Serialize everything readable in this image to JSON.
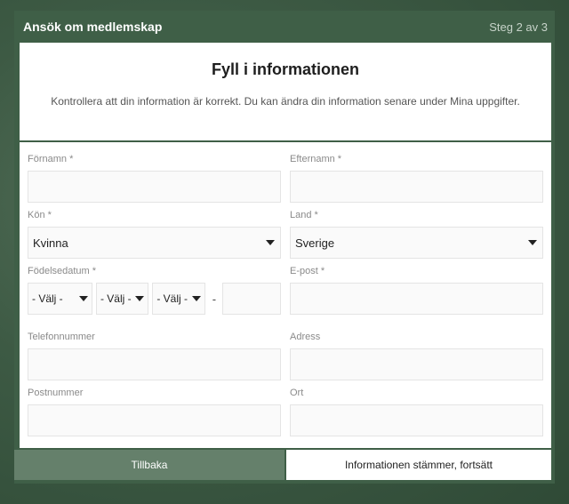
{
  "header": {
    "title": "Ansök om medlemskap",
    "step": "Steg 2 av 3"
  },
  "intro": {
    "title": "Fyll i informationen",
    "text": "Kontrollera att din information är korrekt. Du kan ändra din information senare under Mina uppgifter."
  },
  "form": {
    "first_name": {
      "label": "Förnamn *",
      "value": ""
    },
    "last_name": {
      "label": "Efternamn *",
      "value": ""
    },
    "gender": {
      "label": "Kön *",
      "selected": "Kvinna"
    },
    "country": {
      "label": "Land *",
      "selected": "Sverige"
    },
    "birthdate": {
      "label": "Födelsedatum *",
      "year": "- Välj -",
      "month": "- Välj -",
      "day": "- Välj -",
      "separator": "-",
      "suffix_value": ""
    },
    "email": {
      "label": "E-post *",
      "value": ""
    },
    "phone": {
      "label": "Telefonnummer",
      "value": ""
    },
    "address": {
      "label": "Adress",
      "value": ""
    },
    "postal_code": {
      "label": "Postnummer",
      "value": ""
    },
    "city": {
      "label": "Ort",
      "value": ""
    }
  },
  "buttons": {
    "back": "Tillbaka",
    "next": "Informationen stämmer, fortsätt"
  }
}
